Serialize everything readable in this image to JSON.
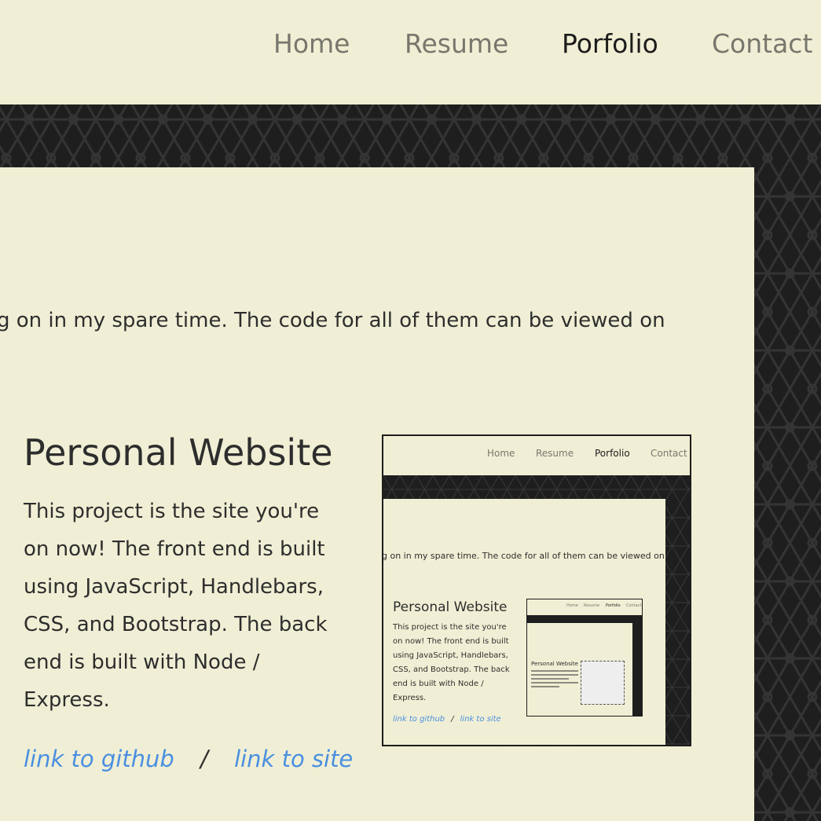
{
  "nav": {
    "items": [
      {
        "label": "Home"
      },
      {
        "label": "Resume"
      },
      {
        "label": "Porfolio"
      },
      {
        "label": "Contact"
      }
    ],
    "active": "Porfolio"
  },
  "main": {
    "intro_fragment": "g on in my spare time. The code for all of them can be viewed on",
    "project": {
      "title": "Personal Website",
      "description": "This project is the site you're on now! The front end is built using JavaScript, Handlebars, CSS, and Bootstrap. The back end is built with Node / Express.",
      "link_github": "link to github",
      "link_separator": "/",
      "link_site": "link to site"
    }
  },
  "thumbnail": {
    "nav": [
      "Home",
      "Resume",
      "Porfolio",
      "Contact"
    ],
    "intro_fragment": "g on in my spare time. The code for all of them can be viewed on",
    "title": "Personal Website",
    "description": "This project is the site you're on now! The front end is built using JavaScript, Handlebars, CSS, and Bootstrap. The back end is built with Node / Express.",
    "link_github": "link to github",
    "link_site": "link to site"
  },
  "colors": {
    "background": "#f0efd5",
    "pattern": "#1e1e1e",
    "link": "#4a8fe0",
    "nav_inactive": "#77776d",
    "nav_active": "#1c1c1c"
  }
}
